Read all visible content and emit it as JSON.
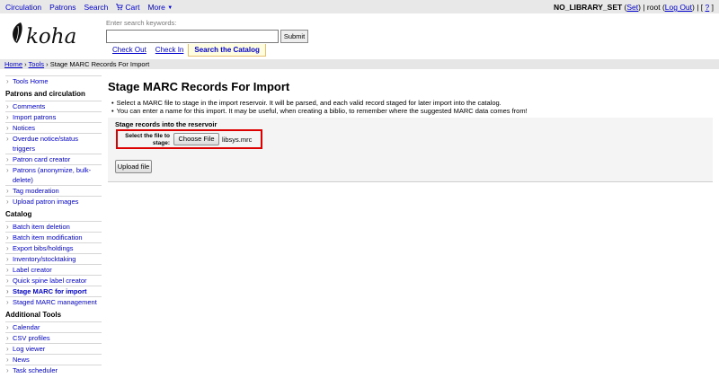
{
  "topnav": {
    "items": [
      "Circulation",
      "Patrons",
      "Search",
      "Cart",
      "More"
    ],
    "library": "NO_LIBRARY_SET",
    "set_label": "Set",
    "user": "root",
    "logout_label": "Log Out",
    "help_label": "?"
  },
  "header": {
    "logo_text": "koha",
    "search_hint": "Enter search keywords:",
    "search_value": "",
    "submit_label": "Submit",
    "tabs": [
      "Check Out",
      "Check In",
      "Search the Catalog"
    ]
  },
  "breadcrumb": {
    "home": "Home",
    "tools": "Tools",
    "current": "Stage MARC Records For Import"
  },
  "sidebar": {
    "tools_home": "Tools Home",
    "sections": [
      {
        "title": "Patrons and circulation",
        "items": [
          "Comments",
          "Import patrons",
          "Notices",
          "Overdue notice/status triggers",
          "Patron card creator",
          "Patrons (anonymize, bulk-delete)",
          "Tag moderation",
          "Upload patron images"
        ]
      },
      {
        "title": "Catalog",
        "items": [
          "Batch item deletion",
          "Batch item modification",
          "Export bibs/holdings",
          "Inventory/stocktaking",
          "Label creator",
          "Quick spine label creator",
          "Stage MARC for import",
          "Staged MARC management"
        ]
      },
      {
        "title": "Additional Tools",
        "items": [
          "Calendar",
          "CSV profiles",
          "Log viewer",
          "News",
          "Task scheduler"
        ]
      }
    ]
  },
  "main": {
    "title": "Stage MARC Records For Import",
    "bullets": [
      "Select a MARC file to stage in the import reservoir. It will be parsed, and each valid record staged for later import into the catalog.",
      "You can enter a name for this import. It may be useful, when creating a biblio, to remember where the suggested MARC data comes from!"
    ],
    "legend": "Stage records into the reservoir",
    "file_label": "Select the file to stage:",
    "choose_label": "Choose File",
    "file_name": "libsys.mrc",
    "upload_label": "Upload file"
  }
}
